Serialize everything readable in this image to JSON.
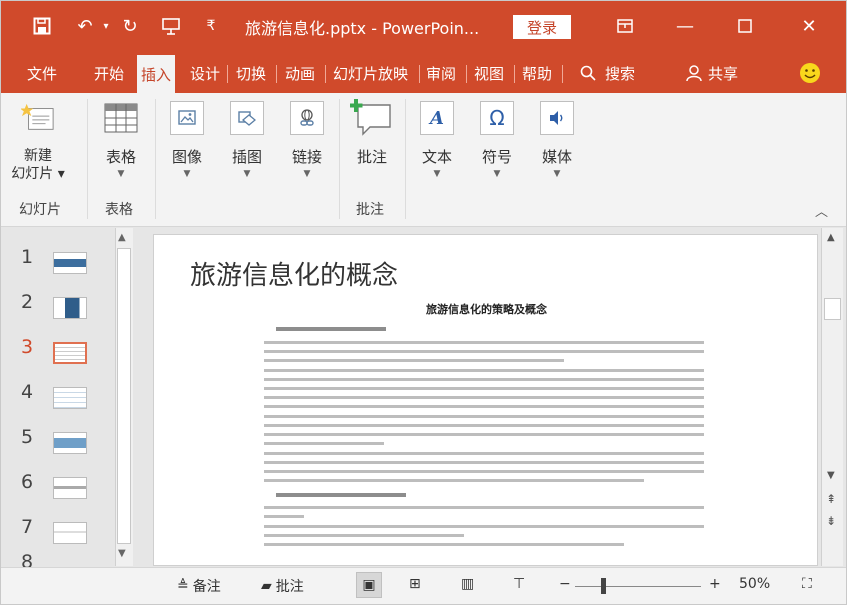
{
  "titlebar": {
    "doc_title": "旅游信息化.pptx  -  PowerPoin...",
    "login_label": "登录"
  },
  "tabs": [
    "文件",
    "开始",
    "插入",
    "设计",
    "切换",
    "动画",
    "幻灯片放映",
    "审阅",
    "视图",
    "帮助"
  ],
  "active_tab": "插入",
  "search_label": "搜索",
  "share_label": "共享",
  "ribbon": {
    "new_slide": "新建\n幻灯片",
    "table": "表格",
    "image": "图像",
    "illustrations": "插图",
    "link": "链接",
    "comment": "批注",
    "text": "文本",
    "symbol": "符号",
    "media": "媒体",
    "group_slides": "幻灯片",
    "group_table": "表格",
    "group_comment": "批注"
  },
  "thumbnails": [
    {
      "num": "1"
    },
    {
      "num": "2"
    },
    {
      "num": "3"
    },
    {
      "num": "4"
    },
    {
      "num": "5"
    },
    {
      "num": "6"
    },
    {
      "num": "7"
    }
  ],
  "selected_slide": "3",
  "slide": {
    "title": "旅游信息化的概念",
    "doc_heading": "旅游信息化的策略及概念"
  },
  "statusbar": {
    "notes_label": "备注",
    "comments_label": "批注",
    "zoom_label": "50%",
    "zoom_level": 0.5
  },
  "colors": {
    "accent": "#d04a2b",
    "ribbon_bg": "#f3f3f3",
    "selected_thumb_border": "#e07050"
  },
  "icons": [
    "save-icon",
    "undo-icon",
    "redo-icon",
    "present-icon",
    "qat-menu-icon",
    "ribbon-display-icon",
    "minimize-icon",
    "maximize-icon",
    "close-icon",
    "search-icon",
    "share-icon",
    "smiley-icon"
  ]
}
